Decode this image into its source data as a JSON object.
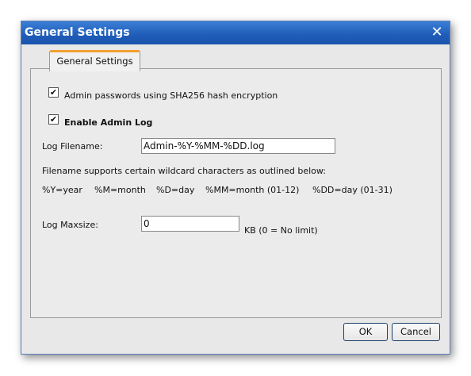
{
  "window": {
    "title": "General Settings",
    "close_icon": "close-icon"
  },
  "tabs": [
    {
      "label": "General Settings",
      "active": true
    }
  ],
  "settings": {
    "sha256": {
      "label": "Admin passwords using SHA256 hash encryption",
      "checked": true
    },
    "enable_log": {
      "label": "Enable Admin Log",
      "checked": true
    },
    "log_filename": {
      "label": "Log Filename:",
      "value": "Admin-%Y-%MM-%DD.log"
    },
    "wildcard_note": "Filename supports certain wildcard characters as outlined below:",
    "wildcards": [
      "%Y=year",
      "%M=month",
      "%D=day",
      "%MM=month (01-12)",
      "%DD=day (01-31)"
    ],
    "log_maxsize": {
      "label": "Log Maxsize:",
      "value": "0",
      "unit": "KB (0 = No limit)"
    }
  },
  "buttons": {
    "ok": "OK",
    "cancel": "Cancel"
  }
}
